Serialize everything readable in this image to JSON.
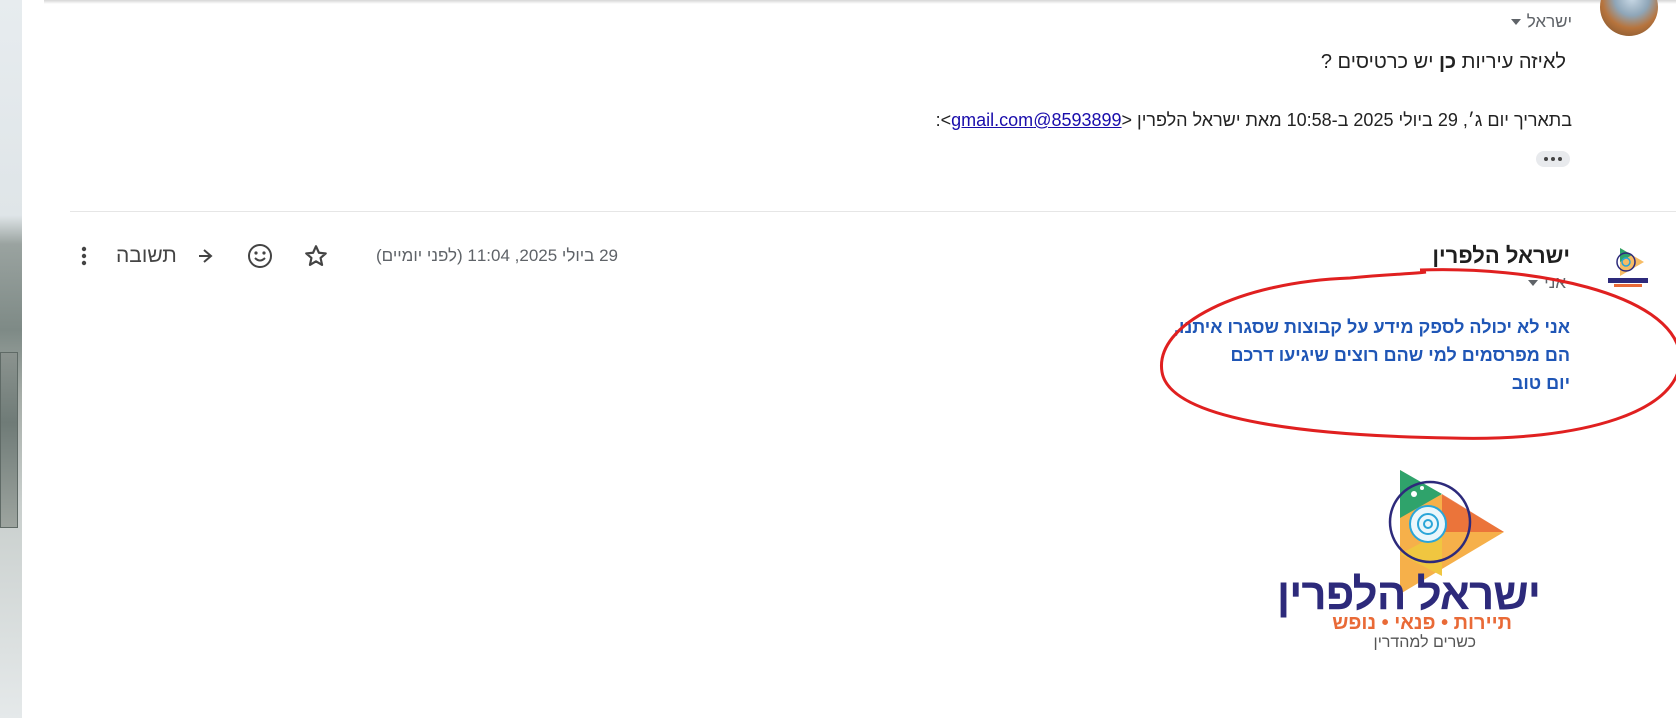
{
  "message1": {
    "to": "ישראל",
    "body_before": "לאיזה עיריות",
    "body_bold": "כן",
    "body_after": "יש כרטיסים ?",
    "quote_prefix": "בתאריך יום ג׳, 29 ביולי 2025 ב-10:58 מאת ישראל הלפרין <",
    "quote_email": "8593899@gmail.com",
    "quote_suffix": ">:"
  },
  "message2": {
    "sender": "ישראל הלפרין",
    "to": "אני",
    "date": "29 ביולי 2025, 11:04 (לפני יומיים)",
    "reply_label": "תשובה",
    "body_lines": [
      "אני לא יכולה לספק מידע על קבוצות שסגרו איתנו,",
      "הם מפרסמים למי שהם רוצים שיגיעו דרכם",
      "יום טוב"
    ],
    "logo": {
      "name": "ישראל הלפרין",
      "tagline": "תיירות • פנאי • נופש",
      "subtitle": "כשרים למהדרין"
    }
  },
  "icons": {
    "star": "star-icon",
    "emoji": "emoji-icon",
    "reply": "reply-icon",
    "more": "more-vert-icon",
    "ellipsis": "ellipsis-icon",
    "caret": "caret-down-icon"
  },
  "colors": {
    "body_text_blue": "#1f56b6",
    "annotation_red": "#e02020",
    "link": "#1a0dab"
  }
}
